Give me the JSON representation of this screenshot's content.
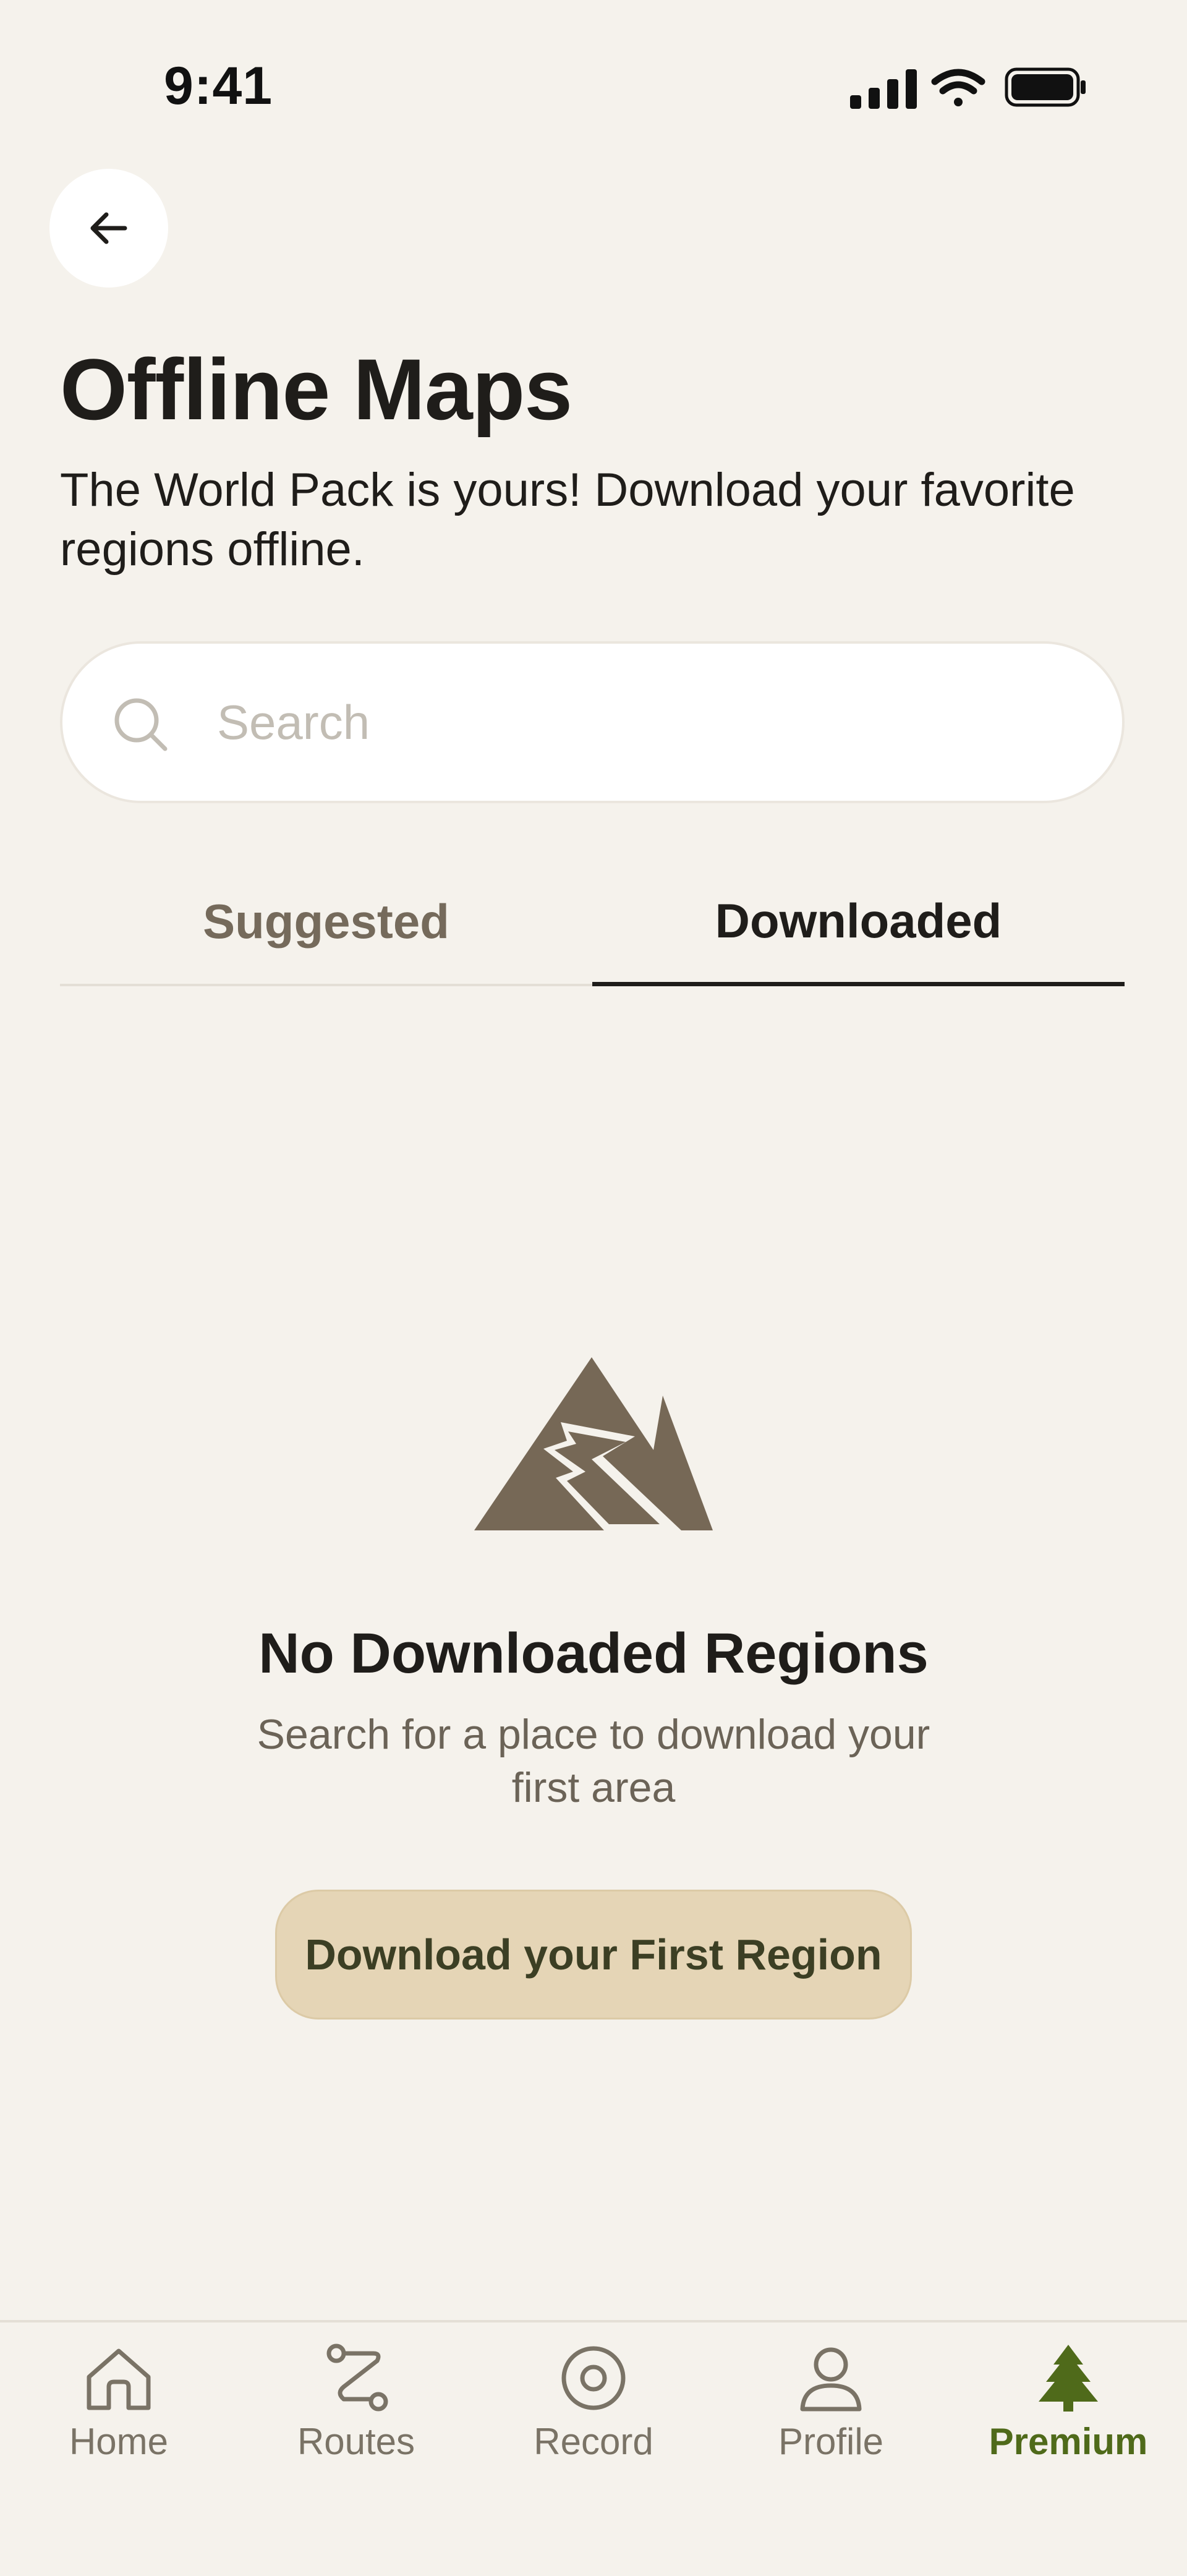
{
  "status_bar": {
    "time": "9:41",
    "icons": [
      "cellular-signal-icon",
      "wifi-icon",
      "battery-icon"
    ]
  },
  "header": {
    "back_icon": "arrow-left-icon",
    "title": "Offline Maps",
    "subtitle": "The World Pack is yours! Download your favorite regions offline."
  },
  "search": {
    "placeholder": "Search",
    "value": "",
    "icon": "search-icon"
  },
  "tabs": [
    {
      "label": "Suggested",
      "active": false
    },
    {
      "label": "Downloaded",
      "active": true
    }
  ],
  "empty_state": {
    "icon": "mountain-trail-icon",
    "title": "No Downloaded Regions",
    "description": "Search for a place to download your first area",
    "button_label": "Download your First Region"
  },
  "bottom_nav": {
    "items": [
      {
        "label": "Home",
        "icon": "home-icon",
        "active": false
      },
      {
        "label": "Routes",
        "icon": "route-icon",
        "active": false
      },
      {
        "label": "Record",
        "icon": "record-icon",
        "active": false
      },
      {
        "label": "Profile",
        "icon": "person-icon",
        "active": false
      },
      {
        "label": "Premium",
        "icon": "tree-icon",
        "active": true
      }
    ]
  },
  "colors": {
    "background": "#f5f2ec",
    "text_primary": "#1f1d1a",
    "text_muted": "#7a7366",
    "accent_green": "#4f6a1a",
    "mountain_brown": "#766856",
    "cta_background": "#e5d5b6"
  }
}
